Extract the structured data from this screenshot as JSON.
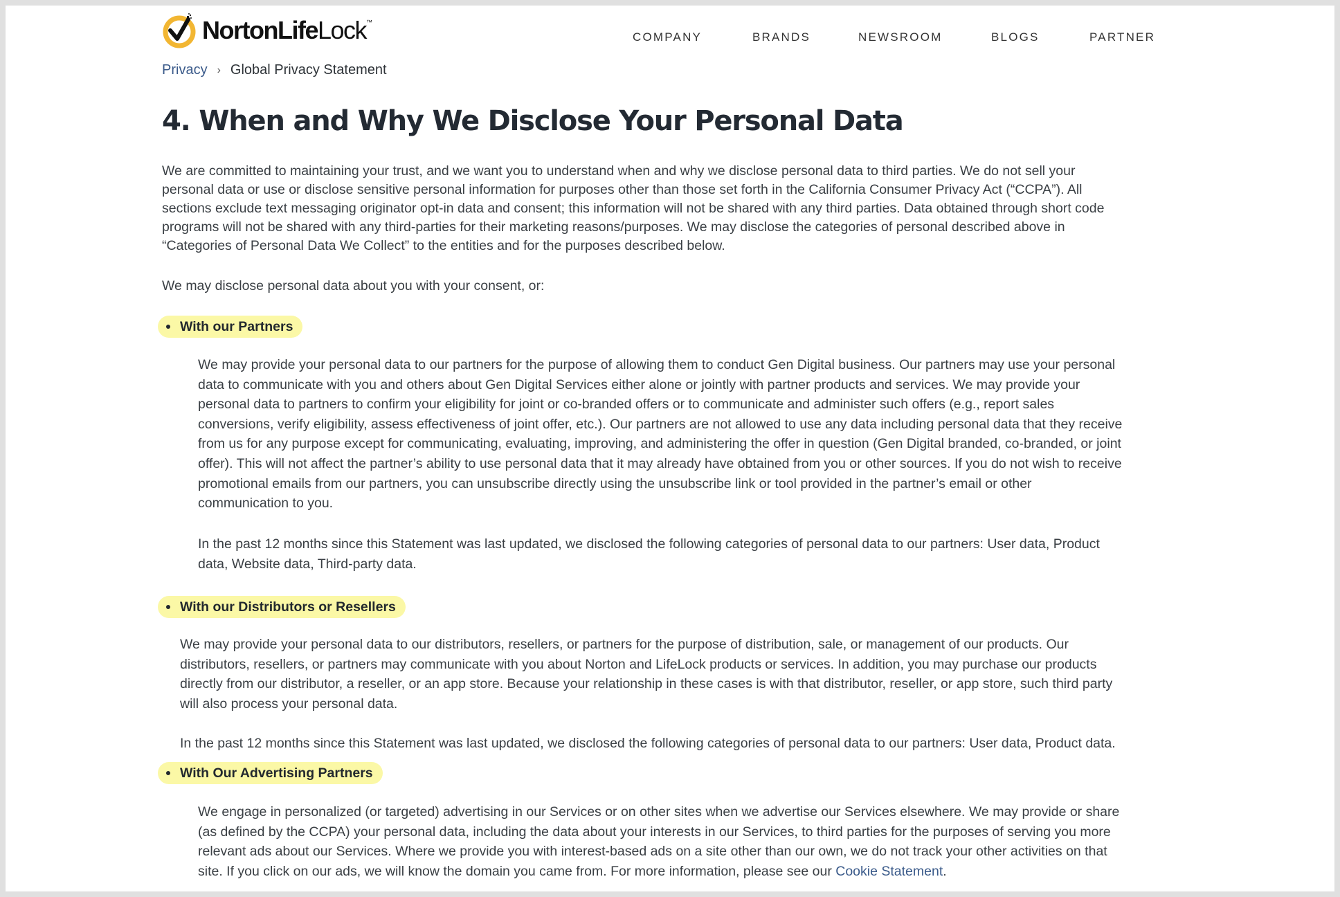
{
  "brand": {
    "name_bold": "NortonLife",
    "name_light": "Lock",
    "trademark": "™",
    "accent_color": "#f2b632"
  },
  "nav": {
    "items": [
      {
        "label": "COMPANY"
      },
      {
        "label": "BRANDS"
      },
      {
        "label": "NEWSROOM"
      },
      {
        "label": "BLOGS"
      },
      {
        "label": "PARTNER"
      }
    ]
  },
  "breadcrumb": {
    "parent": "Privacy",
    "separator": "›",
    "current": "Global Privacy Statement"
  },
  "page_title": "4. When and Why We Disclose Your Personal Data",
  "intro": {
    "lines": [
      "We are committed to maintaining your trust, and we want you to understand when and why we disclose personal data to third parties. We do not sell your",
      "personal data or use or disclose sensitive personal information for purposes other than those set forth in the California Consumer Privacy Act (“CCPA”). All",
      "sections exclude text messaging originator opt-in data and consent; this information will not be shared with any third parties. Data obtained through short code",
      "programs will not be shared with any third-parties for their marketing reasons/purposes. We may disclose the categories of personal described above in",
      "“Categories of Personal Data We Collect” to the entities and for the purposes described below."
    ],
    "consent": "We may disclose personal data about you with your consent, or:"
  },
  "sections": [
    {
      "heading": "With our Partners",
      "body_lines": [
        "We may provide your personal data to our partners for the purpose of allowing them to conduct Gen Digital business. Our partners may use your personal",
        "data to communicate with you and others about Gen Digital Services either alone or jointly with partner products and services. We may provide your",
        "personal data to partners to confirm your eligibility for joint or co-branded offers or to communicate and administer such offers (e.g., report sales",
        "conversions, verify eligibility, assess effectiveness of joint offer, etc.). Our partners are not allowed to use any data including personal data that they receive",
        "from us for any purpose except for communicating, evaluating, improving, and administering the offer in question (Gen Digital branded, co-branded, or joint",
        "offer). This will not affect the partner’s ability to use personal data that it may already have obtained from you or other sources. If you do not wish to receive",
        "promotional emails from our partners, you can unsubscribe directly using the unsubscribe link or tool provided in the partner’s email or other",
        "communication to you."
      ],
      "disclosure_lines": [
        "In the past 12 months since this Statement was last updated, we disclosed the following categories of personal data to our partners: User data, Product",
        "data, Website data, Third-party data."
      ]
    },
    {
      "heading": "With our Distributors or Resellers",
      "body_lines": [
        "We may provide your personal data to our distributors, resellers, or partners for the purpose of distribution, sale, or management of our products. Our",
        "distributors, resellers, or partners may communicate with you about Norton and LifeLock products or services. In addition, you may purchase our products",
        "directly from our distributor, a reseller, or an app store. Because your relationship in these cases is with that distributor, reseller, or app store, such third party",
        "will also process your personal data."
      ],
      "disclosure_lines": [
        "In the past 12 months since this Statement was last updated, we disclosed the following categories of personal data to our partners: User data, Product data."
      ]
    },
    {
      "heading": "With Our Advertising Partners",
      "body_lines": [
        "We engage in personalized (or targeted) advertising in our Services or on other sites when we advertise our Services elsewhere. We may provide or share",
        "(as defined by the CCPA) your personal data, including the data about your interests in our Services, to third parties for the purposes of serving you more",
        "relevant ads about our Services. Where we provide you with interest-based ads on a site other than our own, we do not track your other activities on that"
      ],
      "last_line_prefix": "site. If you click on our ads, we will know the domain you came from. For more information, please see our ",
      "link_text": "Cookie Statement",
      "last_line_suffix": "."
    }
  ]
}
